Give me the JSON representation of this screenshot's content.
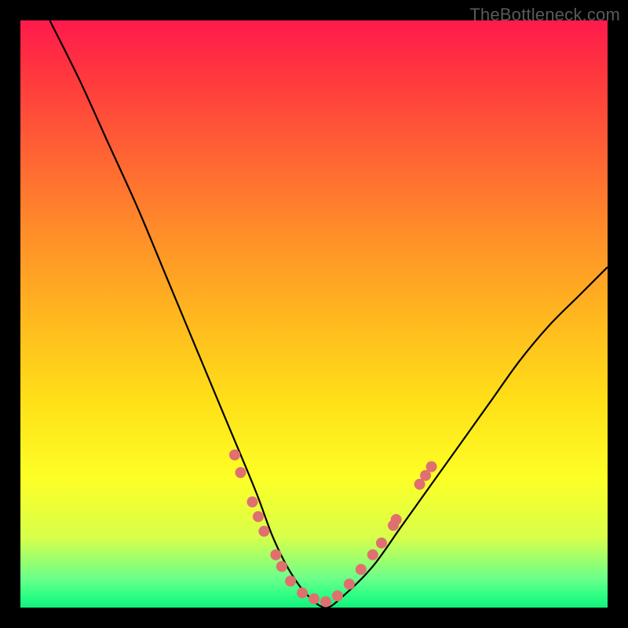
{
  "watermark": "TheBottleneck.com",
  "colors": {
    "dot": "#e07070",
    "curve": "#000000",
    "frame_bg_top": "#ff1a4d",
    "frame_bg_bottom": "#14f07c",
    "page_bg": "#000000"
  },
  "chart_data": {
    "type": "line",
    "title": "",
    "xlabel": "",
    "ylabel": "",
    "xlim": [
      0,
      100
    ],
    "ylim": [
      0,
      100
    ],
    "grid": false,
    "legend": false,
    "series": [
      {
        "name": "bottleneck-curve",
        "x": [
          5,
          10,
          15,
          20,
          25,
          30,
          35,
          40,
          43,
          46,
          49,
          52,
          55,
          60,
          65,
          70,
          75,
          80,
          85,
          90,
          95,
          100
        ],
        "y": [
          100,
          90,
          79,
          68,
          56,
          44,
          32,
          20,
          12,
          6,
          2,
          0,
          2,
          7,
          14,
          21,
          28,
          35,
          42,
          48,
          53,
          58
        ]
      }
    ],
    "annotations": {
      "dots_note": "scatter markers near trough and lower right ascent",
      "dots": [
        {
          "x": 36.5,
          "y": 26
        },
        {
          "x": 37.5,
          "y": 23
        },
        {
          "x": 39.5,
          "y": 18
        },
        {
          "x": 40.5,
          "y": 15.5
        },
        {
          "x": 41.5,
          "y": 13
        },
        {
          "x": 43.5,
          "y": 9
        },
        {
          "x": 44.5,
          "y": 7
        },
        {
          "x": 46,
          "y": 4.5
        },
        {
          "x": 48,
          "y": 2.5
        },
        {
          "x": 50,
          "y": 1.5
        },
        {
          "x": 52,
          "y": 1
        },
        {
          "x": 54,
          "y": 2
        },
        {
          "x": 56,
          "y": 4
        },
        {
          "x": 58,
          "y": 6.5
        },
        {
          "x": 60,
          "y": 9
        },
        {
          "x": 61.5,
          "y": 11
        },
        {
          "x": 63.5,
          "y": 14
        },
        {
          "x": 64,
          "y": 15
        },
        {
          "x": 68,
          "y": 21
        },
        {
          "x": 69,
          "y": 22.5
        },
        {
          "x": 70,
          "y": 24
        }
      ]
    }
  }
}
